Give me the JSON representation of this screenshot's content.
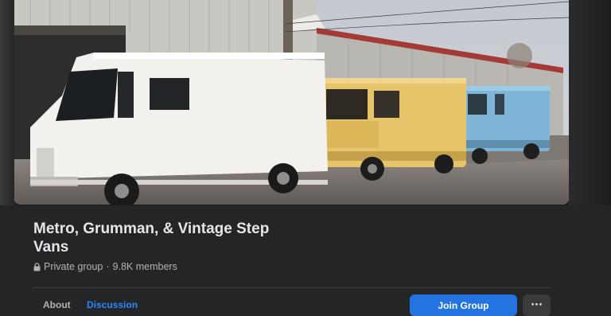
{
  "group": {
    "name": "Metro, Grumman, & Vintage Step Vans",
    "privacy": "Private group",
    "separator": "·",
    "members": "9.8K members"
  },
  "tabs": [
    {
      "label": "About",
      "active": false
    },
    {
      "label": "Discussion",
      "active": true
    }
  ],
  "actions": {
    "join_label": "Join Group",
    "more_icon": "ellipsis-icon"
  },
  "colors": {
    "background": "#18191a",
    "panel": "#242526",
    "accent": "#2374e1",
    "active_tab": "#2d88ff"
  },
  "cover": {
    "vans": [
      "white",
      "yellow",
      "light blue"
    ]
  }
}
